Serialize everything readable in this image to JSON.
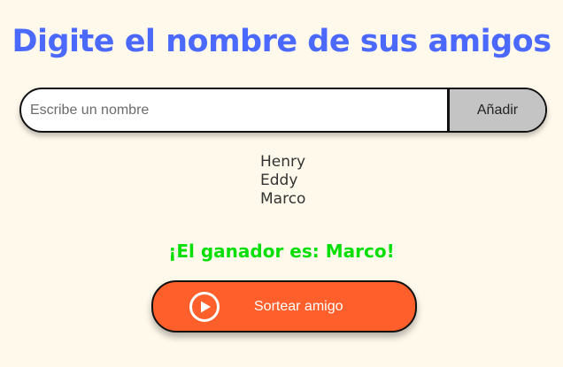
{
  "header": {
    "title": "Digite el nombre de sus amigos"
  },
  "input_section": {
    "placeholder": "Escribe un nombre",
    "value": "",
    "add_label": "Añadir"
  },
  "friends": [
    "Henry",
    "Eddy",
    "Marco"
  ],
  "result": {
    "text": "¡El ganador es: Marco!"
  },
  "draw_button": {
    "label": "Sortear amigo",
    "icon": "play-circle-icon"
  },
  "colors": {
    "background": "#fff9eb",
    "title": "#4b69fd",
    "winner": "#05df05",
    "draw_button": "#ff5f2b",
    "add_button": "#c4c4c4"
  }
}
